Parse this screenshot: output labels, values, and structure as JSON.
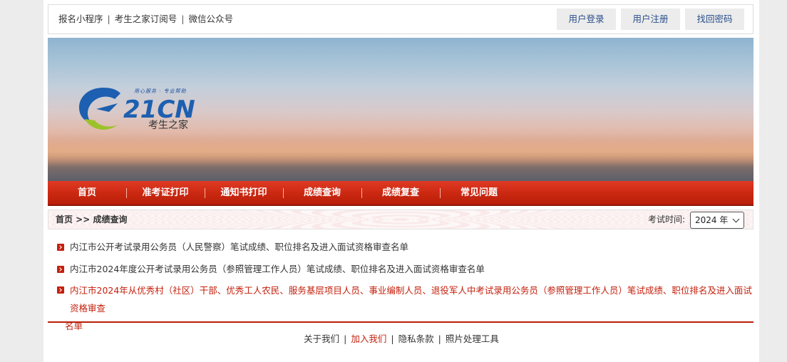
{
  "topbar": {
    "links": [
      "报名小程序",
      "考生之家订阅号",
      "微信公众号"
    ],
    "separator": "|",
    "buttons": {
      "login": "用户登录",
      "register": "用户注册",
      "recover": "找回密码"
    }
  },
  "banner": {
    "logo_text": "21CN",
    "logo_slogan": "用心服务 · 专业帮助",
    "logo_name": "考生之家"
  },
  "nav": {
    "items": [
      "首页",
      "准考证打印",
      "通知书打印",
      "成绩查询",
      "成绩复查",
      "常见问题"
    ]
  },
  "breadcrumb": {
    "text": "首页 >> 成绩查询",
    "year_label": "考试时间:",
    "year_value": "2024 年"
  },
  "list": {
    "items": [
      "内江市公开考试录用公务员（人民警察）笔试成绩、职位排名及进入面试资格审查名单",
      "内江市2024年度公开考试录用公务员（参照管理工作人员）笔试成绩、职位排名及进入面试资格审查名单"
    ],
    "highlight_line1": "内江市2024年从优秀村（社区）干部、优秀工人农民、服务基层项目人员、事业编制人员、退役军人中考试录用公务员（参照管理工作人员）笔试成绩、职位排名及进入面试资格审查",
    "highlight_line2": "名单"
  },
  "footer": {
    "about": "关于我们",
    "join": "加入我们",
    "privacy": "隐私条款",
    "photo_tool": "照片处理工具",
    "separator": "|"
  },
  "colors": {
    "nav_red": "#c8260f",
    "link_blue": "#2a4f8a",
    "highlight_red": "#c4200d"
  }
}
